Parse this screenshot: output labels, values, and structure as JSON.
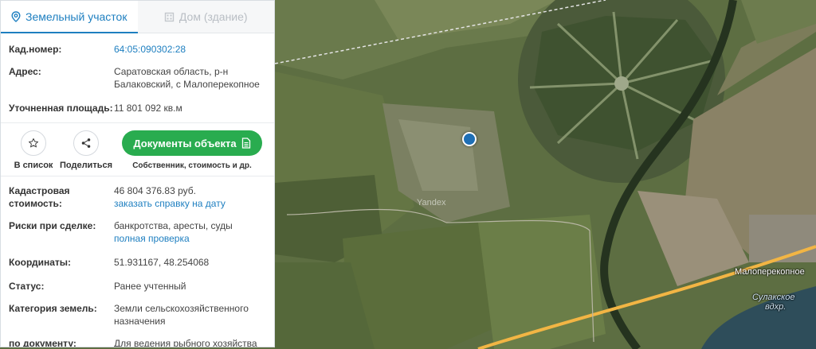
{
  "tabs": {
    "land_label": "Земельный участок",
    "building_label": "Дом (здание)"
  },
  "info": {
    "cadastral_number_label": "Кад.номер:",
    "cadastral_number_value": "64:05:090302:28",
    "address_label": "Адрес:",
    "address_line1": "Саратовская область, р-н",
    "address_line2": "Балаковский, с Малоперекопное",
    "area_label": "Уточненная площадь:",
    "area_value": "11 801 092 кв.м"
  },
  "actions": {
    "favorite_label": "В список",
    "share_label": "Поделиться",
    "documents_label": "Документы объекта",
    "documents_sub": "Собственник, стоимость и др."
  },
  "details": {
    "cost_label_line1": "Кадастровая",
    "cost_label_line2": "стоимость:",
    "cost_value": "46 804 376.83 руб.",
    "cost_link": "заказать справку на дату",
    "risks_label": "Риски при сделке:",
    "risks_value": "банкротства, аресты, суды",
    "risks_link": "полная проверка",
    "coords_label": "Координаты:",
    "coords_value": "51.931167, 48.254068",
    "status_label": "Статус:",
    "status_value": "Ранее учтенный",
    "category_label": "Категория земель:",
    "category_line1": "Земли сельскохозяйственного",
    "category_line2": "назначения",
    "doc_label": "по документу:",
    "doc_value": "Для ведения рыбного хозяйства"
  },
  "map": {
    "village_label": "Малоперекопное",
    "reservoir_line1": "Сулакское",
    "reservoir_line2": "вдхр.",
    "provider_mark": "Yandex"
  },
  "colors": {
    "accent": "#1e7fc0",
    "docs_button": "#29ac4f",
    "marker": "#1f6fb5",
    "road": "#f2b544"
  }
}
